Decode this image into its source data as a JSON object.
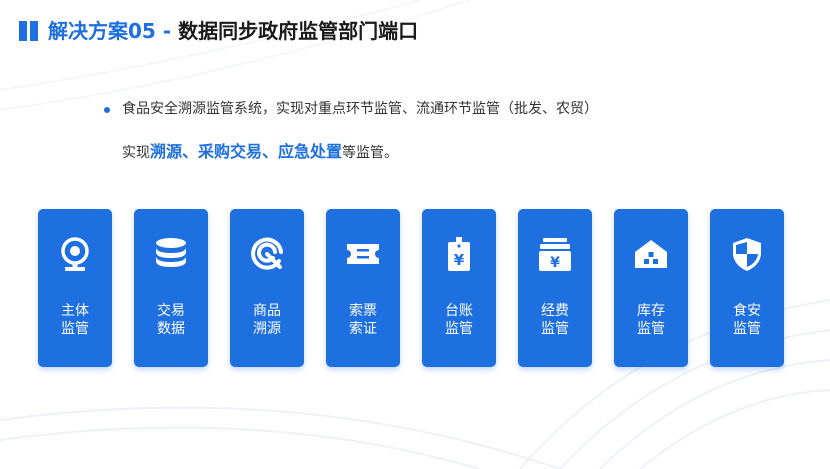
{
  "header": {
    "prefix": "解决方案05",
    "separator": " - ",
    "title": "数据同步政府监管部门端口"
  },
  "content": {
    "line1": "食品安全溯源监管系统，实现对重点环节监管、流通环节监管（批发、农贸）",
    "line2_prefix": "实现",
    "line2_highlight": "溯源、采购交易、应急处置",
    "line2_suffix": "等监管。"
  },
  "cards": [
    {
      "icon": "webcam-icon",
      "line1": "主体",
      "line2": "监管"
    },
    {
      "icon": "database-icon",
      "line1": "交易",
      "line2": "数据"
    },
    {
      "icon": "trace-icon",
      "line1": "商品",
      "line2": "溯源"
    },
    {
      "icon": "ticket-icon",
      "line1": "索票",
      "line2": "索证"
    },
    {
      "icon": "price-tag-icon",
      "line1": "台账",
      "line2": "监管"
    },
    {
      "icon": "money-box-icon",
      "line1": "经费",
      "line2": "监管"
    },
    {
      "icon": "warehouse-icon",
      "line1": "库存",
      "line2": "监管"
    },
    {
      "icon": "shield-icon",
      "line1": "食安",
      "line2": "监管"
    }
  ],
  "colors": {
    "accent": "#1E6FE0",
    "card_text": "#FFFFFF",
    "body_text": "#333333"
  }
}
